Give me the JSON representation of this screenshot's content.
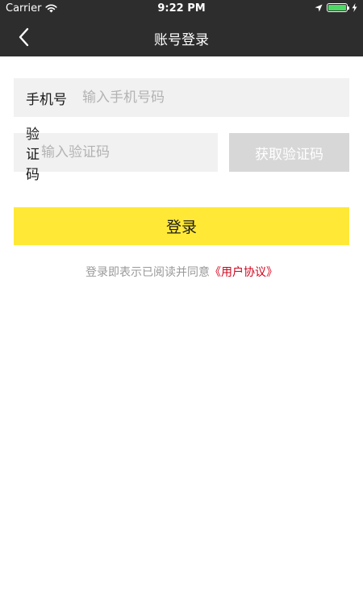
{
  "status_bar": {
    "carrier": "Carrier",
    "time": "9:22 PM",
    "battery_level": 1.0
  },
  "nav": {
    "title": "账号登录"
  },
  "phone_field": {
    "label": "手机号",
    "placeholder": "输入手机号码",
    "value": ""
  },
  "code_field": {
    "label": "验证码",
    "placeholder": "输入验证码",
    "value": ""
  },
  "get_code_button": {
    "label": "获取验证码"
  },
  "login_button": {
    "label": "登录"
  },
  "agreement": {
    "text": "登录即表示已阅读并同意",
    "link": "《用户协议》"
  },
  "colors": {
    "topbar": "#2d2d2d",
    "login_button": "#ffe936",
    "disabled_button": "#d7d7d7",
    "agreement_link": "#d0021b",
    "field_background": "#f1f1f1"
  },
  "icons": {
    "back": "chevron-left-icon",
    "wifi": "wifi-icon",
    "location": "location-arrow-icon",
    "battery": "battery-icon",
    "charging": "charging-bolt-icon"
  }
}
